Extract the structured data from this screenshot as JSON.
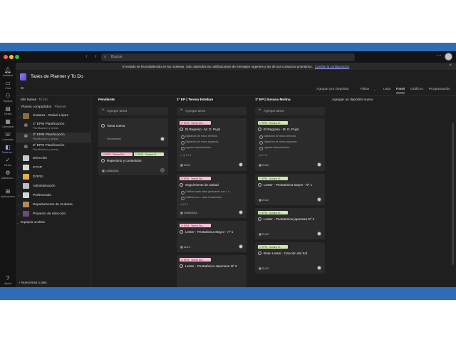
{
  "titlebar": {
    "search_placeholder": "Buscar",
    "nav_arrows": "‹ ›",
    "more": "···"
  },
  "rail": [
    {
      "label": "Actividad",
      "icon": "bell-icon"
    },
    {
      "label": "Chat",
      "icon": "chat-icon"
    },
    {
      "label": "Equipos",
      "icon": "teams-icon"
    },
    {
      "label": "Tareas",
      "icon": "tasks-icon"
    },
    {
      "label": "Calendario",
      "icon": "calendar-icon"
    },
    {
      "label": "Llamadas",
      "icon": "phone-icon"
    },
    {
      "label": "Tasks de...",
      "icon": "planner-icon"
    },
    {
      "label": "Tareas",
      "icon": "check-icon"
    },
    {
      "label": "Aplicacion...",
      "icon": "apps-icon"
    },
    {
      "label": "Aplicaciones",
      "icon": "grid-icon"
    },
    {
      "label": "Ayuda",
      "icon": "help-icon"
    }
  ],
  "notice": {
    "text": "El estado se ha establecido en No molestar. Solo obtendrá las notificaciones de mensajes urgentes y las de sus contactos prioritarios.",
    "link": "Cambie la configuración"
  },
  "header": {
    "title": "Tasks de Planner y To Do"
  },
  "toolbar": {
    "group_by": "Agrupar por Depósito",
    "filter": "Filtrar",
    "views": [
      "Lista",
      "Panel",
      "Gráficos",
      "Programación"
    ],
    "active_view": "Panel"
  },
  "sidebar": {
    "my_tasks": "Mis tareas",
    "to_do": "To Do",
    "shared_plans": "Planes compartidos",
    "planner": "Planner",
    "owner": "Guitarra - Rafael López",
    "plans": [
      {
        "title": "1º EPM Planificación",
        "sub": "Planificación y tareas"
      },
      {
        "title": "3º ERM Planificación",
        "sub": "Planificación y tareas"
      },
      {
        "title": "5º EPM Planificación",
        "sub": "Planificación y tareas"
      }
    ],
    "teams": [
      "Dirección",
      "CTCP",
      "DOFEI",
      "Administración",
      "Profesorado",
      "Departamento de Guitarra",
      "Proyecto de dirección"
    ],
    "hidden_teams": "Equipos ocultos",
    "new_plan": "Nueva lista o plan"
  },
  "board": {
    "add_task": "Agregar tarea",
    "add_bucket": "Agregar un depósito nuevo",
    "columns": {
      "pendiente": {
        "title": "Pendiente",
        "new_task": "Tarea nueva",
        "new_task_note": "Vencimiento",
        "card": {
          "tags": [
            "1º EPM - Teresa Est...",
            "1º EPM - Susana M..."
          ],
          "title": "Repertorio y contenidos",
          "date": "14/06/2024"
        }
      },
      "teresa": {
        "title": "1º EP | Teresa Esteban",
        "cards": [
          {
            "tag": "1º EPM - Teresa Est...",
            "title": "El Regreso - M. D. Pujol",
            "checks": [
              "Digitación de mano derecha",
              "Digitación de mano izquierda",
              "Ligados descendentes"
            ],
            "progress": "0 / 3",
            "date": "12/12"
          },
          {
            "tag": "1º EPM - Teresa Est...",
            "title": "Seguimiento de actitud",
            "checks": [
              "Calificar cada clase puntuando con + o -",
              "Calificar con - cada 3 ausencias"
            ],
            "progress": "0 / 2",
            "date": "19/06/2024"
          },
          {
            "tag": "1º EPM - Teresa Est...",
            "title": "Lester - Pentatónica Mayor - nº 1",
            "date": "11/12"
          },
          {
            "tag": "1º EPM - Teresa Est...",
            "title": "Lester - Pentatónica Japonesa Nº 2"
          }
        ]
      },
      "susana": {
        "title": "1º EP | Susana Molina",
        "cards": [
          {
            "tag": "1º EPM - Susana M...",
            "title": "El Regreso - M. D. Pujol",
            "checks": [
              "Digitación de mano derecha",
              "Digitación de mano izquierda",
              "Ligados descendentes"
            ],
            "progress": "0 / 3",
            "date": "21/12"
          },
          {
            "tag": "1º EPM - Susana M...",
            "title": "Lester - Pentatónica Mayor - Nº 1",
            "date": "21/12"
          },
          {
            "tag": "1º EPM - Susana M...",
            "title": "Lester - Pentatónica japonesa Nº 2",
            "date": "21/12"
          },
          {
            "tag": "1º EPM - Susana M...",
            "title": "Brian Lester - Canción del Sol",
            "date": "21/12"
          }
        ]
      }
    }
  },
  "colors": {
    "accent": "#9aa3ff",
    "tag_pink": "#f7bfd6",
    "tag_green": "#cde9b1",
    "app_bg": "#1f1f1f",
    "frame_blue": "#2e6db5"
  }
}
